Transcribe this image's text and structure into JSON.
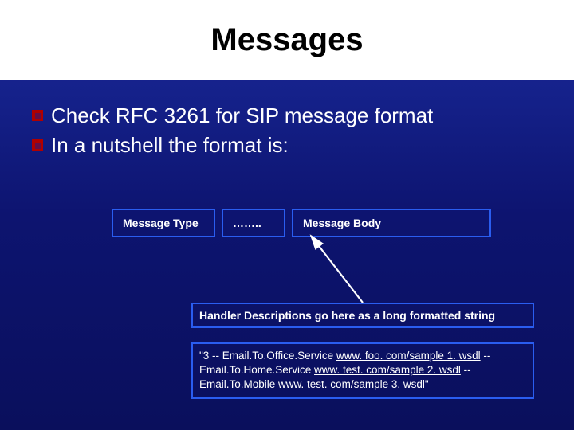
{
  "title": "Messages",
  "bullets": [
    "Check RFC 3261 for SIP message format",
    "In a nutshell the format is:"
  ],
  "row": {
    "type": "Message Type",
    "dots": "……..",
    "body": "Message Body"
  },
  "handler_desc": "Handler Descriptions go here as a long formatted string",
  "sample": {
    "lead": "\"3 -- Email.To.Office.Service ",
    "url1": "www. foo. com/sample 1. wsdl",
    "mid1": " -- Email.To.Home.Service ",
    "url2": "www. test. com/sample 2. wsdl",
    "mid2": " -- Email.To.Mobile ",
    "url3": "www. test. com/sample 3. wsdl",
    "tail": "\""
  }
}
